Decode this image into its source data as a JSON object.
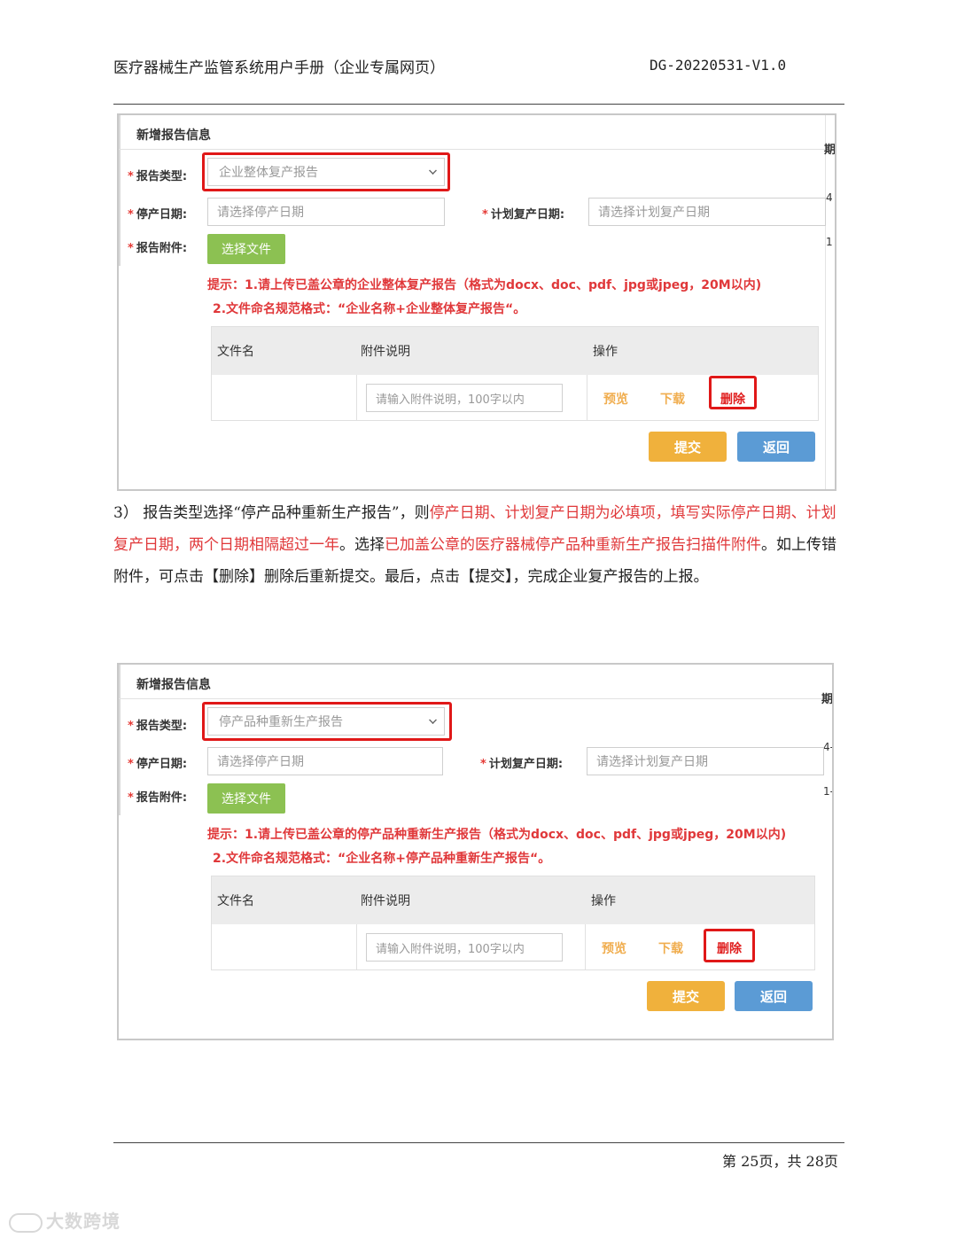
{
  "header": {
    "title": "医疗器械生产监管系统用户手册（企业专属网页）",
    "code": "DG-20220531-V1.0"
  },
  "form1": {
    "card_title": "新增报告信息",
    "edge_tab": "期",
    "edge_frag_1": "4",
    "edge_frag_2": "1",
    "report_type_label": "报告类型:",
    "report_type_value": "企业整体复产报告",
    "stop_date_label": "停产日期:",
    "stop_date_placeholder": "请选择停产日期",
    "plan_date_label": "计划复产日期:",
    "plan_date_placeholder": "请选择计划复产日期",
    "attachment_label": "报告附件:",
    "choose_file": "选择文件",
    "hint1": "提示：1.请上传已盖公章的企业整体复产报告（格式为docx、doc、pdf、jpg或jpeg，20M以内)",
    "hint2": "2.文件命名规范格式：“企业名称+企业整体复产报告“。",
    "col_filename": "文件名",
    "col_desc": "附件说明",
    "col_ops": "操作",
    "desc_placeholder": "请输入附件说明，100字以内",
    "op_preview": "预览",
    "op_download": "下载",
    "op_delete": "删除",
    "submit": "提交",
    "back": "返回"
  },
  "paragraph": {
    "p1": "3） 报告类型选择“停产品种重新生产报告”，则",
    "p2": "停产日期、计划复产日期为必填项，填写实际停产日期、计划复产日期，两个日期相隔超过一年",
    "p3": "。选择",
    "p4": "已加盖公章的医疗器械停产品种重新生产报告扫描件附件",
    "p5": "。如上传错附件，可点击【删除】删除后重新提交。最后，点击【提交】，完成企业复产报告的上报。"
  },
  "form2": {
    "card_title": "新增报告信息",
    "edge_tab": "期",
    "edge_frag_1": "4-",
    "edge_frag_2": "1-",
    "report_type_label": "报告类型:",
    "report_type_value": "停产品种重新生产报告",
    "stop_date_label": "停产日期:",
    "stop_date_placeholder": "请选择停产日期",
    "plan_date_label": "计划复产日期:",
    "plan_date_placeholder": "请选择计划复产日期",
    "attachment_label": "报告附件:",
    "choose_file": "选择文件",
    "hint1": "提示：1.请上传已盖公章的停产品种重新生产报告（格式为docx、doc、pdf、jpg或jpeg，20M以内)",
    "hint2": "2.文件命名规范格式：“企业名称+停产品种重新生产报告“。",
    "col_filename": "文件名",
    "col_desc": "附件说明",
    "col_ops": "操作",
    "desc_placeholder": "请输入附件说明，100字以内",
    "op_preview": "预览",
    "op_download": "下载",
    "op_delete": "删除",
    "submit": "提交",
    "back": "返回"
  },
  "footer": {
    "page_number": "第 25页，共 28页"
  },
  "watermark": {
    "text": "大数跨境"
  },
  "colors": {
    "highlight_red": "#e01818",
    "text_red": "#e0383a",
    "btn_green": "#8cc152",
    "btn_orange": "#f0b13c",
    "btn_blue": "#5b9bd5"
  }
}
